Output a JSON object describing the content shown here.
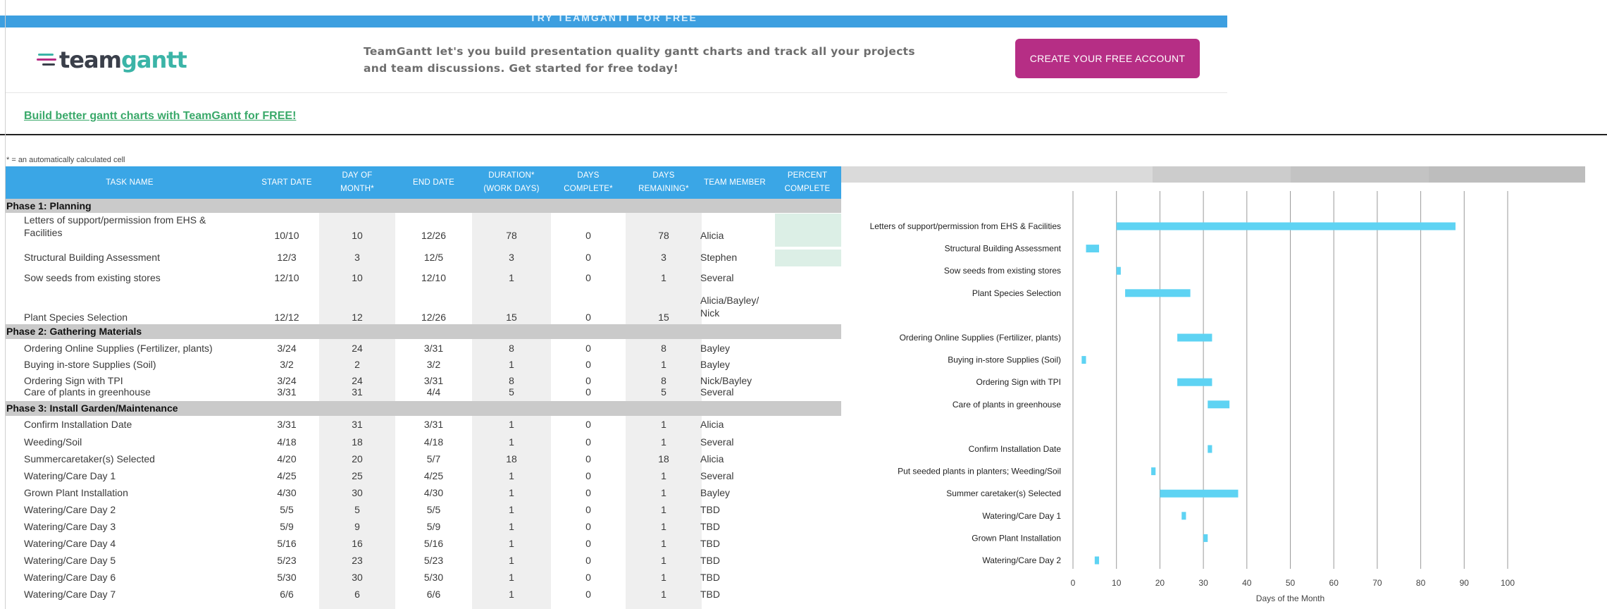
{
  "banner": {
    "top_strip": "TRY TEAMGANTT FOR FREE",
    "logo_team": "team",
    "logo_gantt": "gantt",
    "text_line1": "TeamGantt let's you build presentation quality gantt charts and track all your projects",
    "text_line2": "and team discussions. Get started for free today!",
    "cta_label": "CREATE YOUR FREE ACCOUNT",
    "promo_link": "Build better gantt charts with TeamGantt for FREE!"
  },
  "note": "* = an automatically calculated cell",
  "colors": {
    "header_blue": "#3aa6e6",
    "cta_magenta": "#b62e85",
    "bar_cyan": "#5ed3f3",
    "phase_gray": "#cacaca"
  },
  "table": {
    "headers": {
      "task": "TASK NAME",
      "start": "START DATE",
      "dom1": "DAY OF",
      "dom2": "MONTH*",
      "end": "END DATE",
      "dur1": "DURATION*",
      "dur2": "(WORK DAYS)",
      "dc1": "DAYS",
      "dc2": "COMPLETE*",
      "dr1": "DAYS",
      "dr2": "REMAINING*",
      "team": "TEAM MEMBER",
      "pc1": "PERCENT",
      "pc2": "COMPLETE"
    },
    "phases": [
      {
        "label": "Phase 1: Planning",
        "tasks": [
          {
            "task": "Letters of support/permission from EHS & Facilities",
            "start": "10/10",
            "dom": "10",
            "end": "12/26",
            "dur": "78",
            "dc": "0",
            "dr": "78",
            "team": "Alicia"
          },
          {
            "task": "Structural Building Assessment",
            "start": "12/3",
            "dom": "3",
            "end": "12/5",
            "dur": "3",
            "dc": "0",
            "dr": "3",
            "team": "Stephen"
          },
          {
            "task": "Sow seeds from existing stores",
            "start": "12/10",
            "dom": "10",
            "end": "12/10",
            "dur": "1",
            "dc": "0",
            "dr": "1",
            "team": "Several"
          },
          {
            "task": "Plant Species Selection",
            "start": "12/12",
            "dom": "12",
            "end": "12/26",
            "dur": "15",
            "dc": "0",
            "dr": "15",
            "team": "Alicia/Bayley/ Nick"
          }
        ]
      },
      {
        "label": "Phase 2: Gathering Materials",
        "tasks": [
          {
            "task": "Ordering Online Supplies (Fertilizer, plants)",
            "start": "3/24",
            "dom": "24",
            "end": "3/31",
            "dur": "8",
            "dc": "0",
            "dr": "8",
            "team": "Bayley"
          },
          {
            "task": "Buying in-store Supplies (Soil)",
            "start": "3/2",
            "dom": "2",
            "end": "3/2",
            "dur": "1",
            "dc": "0",
            "dr": "1",
            "team": "Bayley"
          },
          {
            "task": "Ordering Sign with TPI",
            "start": "3/24",
            "dom": "24",
            "end": "3/31",
            "dur": "8",
            "dc": "0",
            "dr": "8",
            "team": "Nick/Bayley"
          },
          {
            "task": "Care of plants in greenhouse",
            "start": "3/31",
            "dom": "31",
            "end": "4/4",
            "dur": "5",
            "dc": "0",
            "dr": "5",
            "team": "Several"
          }
        ]
      },
      {
        "label": "Phase 3: Install Garden/Maintenance",
        "tasks": [
          {
            "task": "Confirm Installation Date",
            "start": "3/31",
            "dom": "31",
            "end": "3/31",
            "dur": "1",
            "dc": "0",
            "dr": "1",
            "team": "Alicia"
          },
          {
            "task": "Weeding/Soil",
            "start": "4/18",
            "dom": "18",
            "end": "4/18",
            "dur": "1",
            "dc": "0",
            "dr": "1",
            "team": "Several"
          },
          {
            "task": "Summercaretaker(s) Selected",
            "start": "4/20",
            "dom": "20",
            "end": "5/7",
            "dur": "18",
            "dc": "0",
            "dr": "18",
            "team": "Alicia"
          },
          {
            "task": "Watering/Care Day 1",
            "start": "4/25",
            "dom": "25",
            "end": "4/25",
            "dur": "1",
            "dc": "0",
            "dr": "1",
            "team": "Several"
          },
          {
            "task": "Grown Plant Installation",
            "start": "4/30",
            "dom": "30",
            "end": "4/30",
            "dur": "1",
            "dc": "0",
            "dr": "1",
            "team": "Bayley"
          },
          {
            "task": "Watering/Care Day 2",
            "start": "5/5",
            "dom": "5",
            "end": "5/5",
            "dur": "1",
            "dc": "0",
            "dr": "1",
            "team": "TBD"
          },
          {
            "task": "Watering/Care Day 3",
            "start": "5/9",
            "dom": "9",
            "end": "5/9",
            "dur": "1",
            "dc": "0",
            "dr": "1",
            "team": "TBD"
          },
          {
            "task": "Watering/Care Day 4",
            "start": "5/16",
            "dom": "16",
            "end": "5/16",
            "dur": "1",
            "dc": "0",
            "dr": "1",
            "team": "TBD"
          },
          {
            "task": "Watering/Care Day 5",
            "start": "5/23",
            "dom": "23",
            "end": "5/23",
            "dur": "1",
            "dc": "0",
            "dr": "1",
            "team": "TBD"
          },
          {
            "task": "Watering/Care Day 6",
            "start": "5/30",
            "dom": "30",
            "end": "5/30",
            "dur": "1",
            "dc": "0",
            "dr": "1",
            "team": "TBD"
          },
          {
            "task": "Watering/Care Day 7",
            "start": "6/6",
            "dom": "6",
            "end": "6/6",
            "dur": "1",
            "dc": "0",
            "dr": "1",
            "team": "TBD"
          }
        ]
      }
    ]
  },
  "chart_data": {
    "type": "bar",
    "orientation": "horizontal-gantt",
    "xlabel": "Days of the Month",
    "xlim": [
      0,
      100
    ],
    "xticks": [
      0,
      10,
      20,
      30,
      40,
      50,
      60,
      70,
      80,
      90,
      100
    ],
    "grid": true,
    "bars": [
      {
        "label": "Letters of support/permission from EHS & Facilities",
        "start": 10,
        "duration": 78
      },
      {
        "label": "Structural Building Assessment",
        "start": 3,
        "duration": 3
      },
      {
        "label": "Sow seeds from existing stores",
        "start": 10,
        "duration": 1
      },
      {
        "label": "Plant Species Selection",
        "start": 12,
        "duration": 15
      },
      {
        "label": "",
        "start": null,
        "duration": null
      },
      {
        "label": "Ordering Online Supplies (Fertilizer, plants)",
        "start": 24,
        "duration": 8
      },
      {
        "label": "Buying in-store Supplies (Soil)",
        "start": 2,
        "duration": 1
      },
      {
        "label": "Ordering Sign with TPI",
        "start": 24,
        "duration": 8
      },
      {
        "label": "Care of plants in greenhouse",
        "start": 31,
        "duration": 5
      },
      {
        "label": "",
        "start": null,
        "duration": null
      },
      {
        "label": "Confirm Installation Date",
        "start": 31,
        "duration": 1
      },
      {
        "label": "Put seeded plants in planters; Weeding/Soil",
        "start": 18,
        "duration": 1
      },
      {
        "label": "Summer caretaker(s) Selected",
        "start": 20,
        "duration": 18
      },
      {
        "label": "Watering/Care Day 1",
        "start": 25,
        "duration": 1
      },
      {
        "label": "Grown Plant Installation",
        "start": 30,
        "duration": 1
      },
      {
        "label": "Watering/Care Day 2",
        "start": 5,
        "duration": 1
      }
    ]
  }
}
